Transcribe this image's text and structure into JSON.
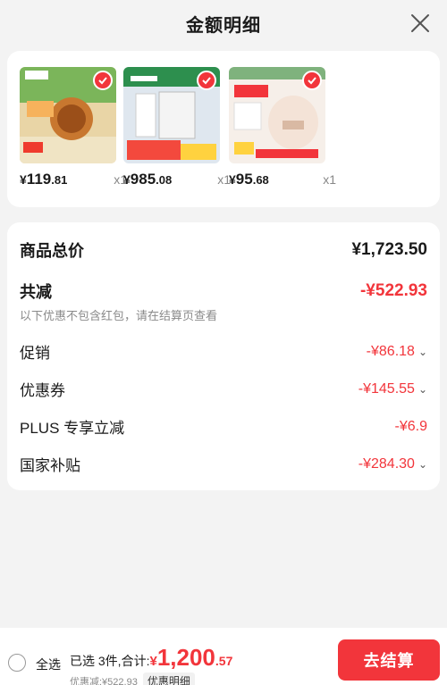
{
  "header": {
    "title": "金额明细"
  },
  "products": [
    {
      "price_yen": "¥",
      "price_int": "119",
      "price_dec": ".81",
      "qty": "x1",
      "brand": "Midea"
    },
    {
      "price_yen": "¥",
      "price_int": "985",
      "price_dec": ".08",
      "qty": "x1",
      "brand": "Midea"
    },
    {
      "price_yen": "¥",
      "price_int": "95",
      "price_dec": ".68",
      "qty": "x1",
      "brand": "WAHIN"
    }
  ],
  "detail": {
    "total_label": "商品总价",
    "total_value": "¥1,723.50",
    "discount_label": "共减",
    "discount_value": "-¥522.93",
    "discount_note": "以下优惠不包含红包，请在结算页查看",
    "items": [
      {
        "label": "促销",
        "value": "-¥86.18"
      },
      {
        "label": "优惠券",
        "value": "-¥145.55"
      },
      {
        "label": "PLUS 专享立减",
        "value": "-¥6.9"
      },
      {
        "label": "国家补贴",
        "value": "-¥284.30"
      }
    ]
  },
  "footer": {
    "select_all": "全选",
    "summary_text": "已选 3件,合计:",
    "sum_yen": "¥",
    "sum_int": "1,200",
    "sum_dec": ".57",
    "discount_line": "优惠减:¥522.93",
    "detail_button": "优惠明细",
    "checkout_button": "去结算"
  },
  "colors": {
    "accent": "#f2353b",
    "background": "#f3f3f3"
  }
}
